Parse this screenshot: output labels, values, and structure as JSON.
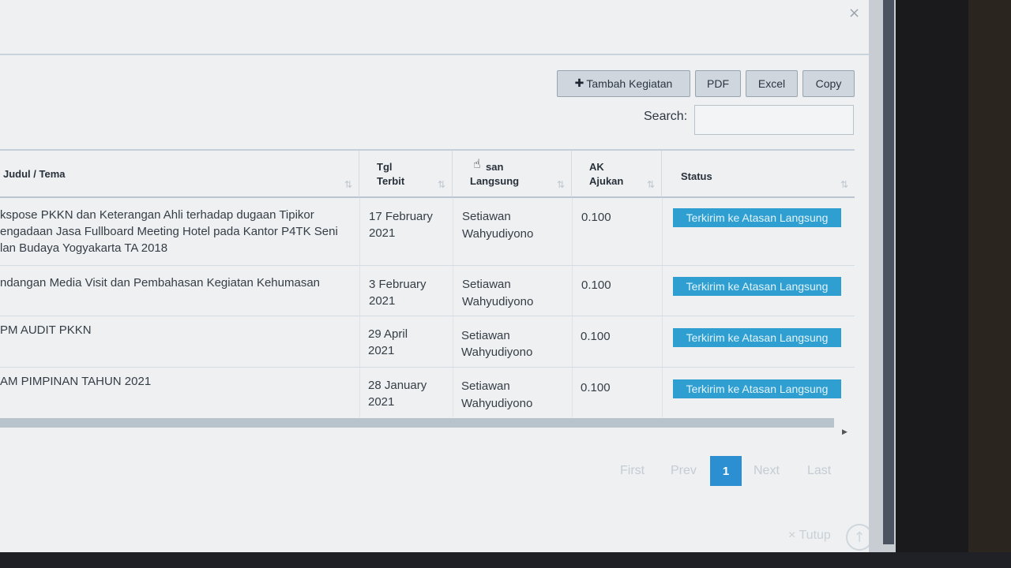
{
  "dialog": {
    "close_icon": "×"
  },
  "toolbar": {
    "add_label": "Tambah Kegiatan",
    "pdf_label": "PDF",
    "excel_label": "Excel",
    "copy_label": "Copy"
  },
  "search": {
    "label": "Search:",
    "value": "",
    "placeholder": ""
  },
  "table": {
    "headers": {
      "judul": "Judul / Tema",
      "tgl_line1": "Tgl",
      "tgl_line2": "Terbit",
      "atasan_line1": "san",
      "atasan_line2": "Langsung",
      "ak_line1": "AK",
      "ak_line2": "Ajukan",
      "status": "Status"
    },
    "sort_glyph": "⇅",
    "rows": [
      {
        "judul_1": "kspose PKKN dan Keterangan Ahli terhadap dugaan Tipikor",
        "judul_2": "engadaan Jasa Fullboard Meeting Hotel pada Kantor P4TK Seni",
        "judul_3": "lan Budaya Yogyakarta TA 2018",
        "tgl_1": "17 February",
        "tgl_2": "2021",
        "atasan_1": "Setiawan",
        "atasan_2": "Wahyudiyono",
        "ak": "0.100",
        "status": "Terkirim ke Atasan Langsung"
      },
      {
        "judul_1": "ndangan Media Visit dan Pembahasan Kegiatan Kehumasan",
        "tgl_1": "3 February",
        "tgl_2": "2021",
        "atasan_1": "Setiawan",
        "atasan_2": "Wahyudiyono",
        "ak": "0.100",
        "status": "Terkirim ke Atasan Langsung"
      },
      {
        "judul_1": "PM AUDIT PKKN",
        "tgl_1": "29 April",
        "tgl_2": "2021",
        "atasan_1": "Setiawan",
        "atasan_2": "Wahyudiyono",
        "ak": "0.100",
        "status": "Terkirim ke Atasan Langsung"
      },
      {
        "judul_1": "AM PIMPINAN TAHUN 2021",
        "tgl_1": "28 January",
        "tgl_2": "2021",
        "atasan_1": "Setiawan",
        "atasan_2": "Wahyudiyono",
        "ak": "0.100",
        "status": "Terkirim ke Atasan Langsung"
      }
    ]
  },
  "pagination": {
    "first": "First",
    "prev": "Prev",
    "current": "1",
    "next": "Next",
    "last": "Last"
  },
  "footer": {
    "close_label": "× Tutup",
    "up_icon": "↑"
  },
  "colors": {
    "status_badge": "#2e9fd0",
    "active_page": "#2b8fd1"
  }
}
